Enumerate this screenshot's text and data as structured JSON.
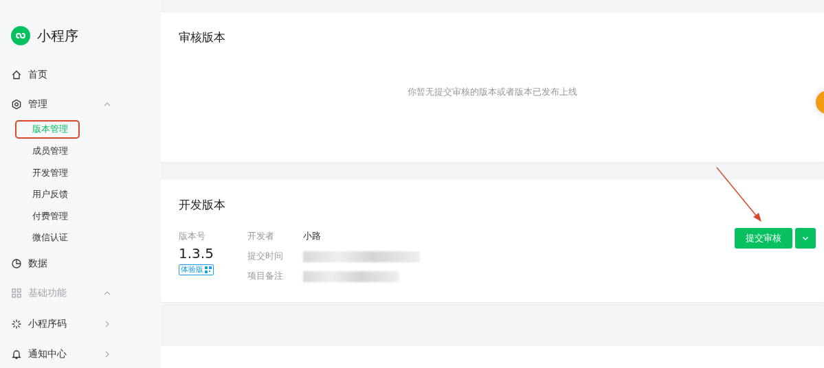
{
  "sidebar": {
    "logo": {
      "title": "小程序"
    },
    "items": [
      {
        "kind": "link",
        "label": "首页"
      },
      {
        "kind": "group",
        "label": "管理",
        "expanded": true,
        "disabled": false,
        "children": [
          {
            "label": "版本管理",
            "selected": true,
            "annotated": true
          },
          {
            "label": "成员管理",
            "selected": false,
            "annotated": false
          },
          {
            "label": "开发管理",
            "selected": false,
            "annotated": false
          },
          {
            "label": "用户反馈",
            "selected": false,
            "annotated": false
          },
          {
            "label": "付费管理",
            "selected": false,
            "annotated": false
          },
          {
            "label": "微信认证",
            "selected": false,
            "annotated": false
          }
        ]
      },
      {
        "kind": "link",
        "label": "数据"
      },
      {
        "kind": "group",
        "label": "基础功能",
        "expanded": true,
        "disabled": true
      },
      {
        "kind": "group",
        "label": "小程序码",
        "expanded": false,
        "disabled": false
      },
      {
        "kind": "group",
        "label": "通知中心",
        "expanded": false,
        "disabled": false
      }
    ]
  },
  "review_card": {
    "title": "审核版本",
    "empty_text": "你暂无提交审核的版本或者版本已发布上线"
  },
  "dev_card": {
    "title": "开发版本",
    "version_label": "版本号",
    "version": "1.3.5",
    "tag": "体验版",
    "fields": [
      {
        "label": "开发者",
        "value": "小路"
      },
      {
        "label": "提交时间",
        "redacted": true
      },
      {
        "label": "项目备注",
        "redacted": true
      }
    ],
    "submit_button": "提交审核",
    "arrow_annotation": true
  }
}
